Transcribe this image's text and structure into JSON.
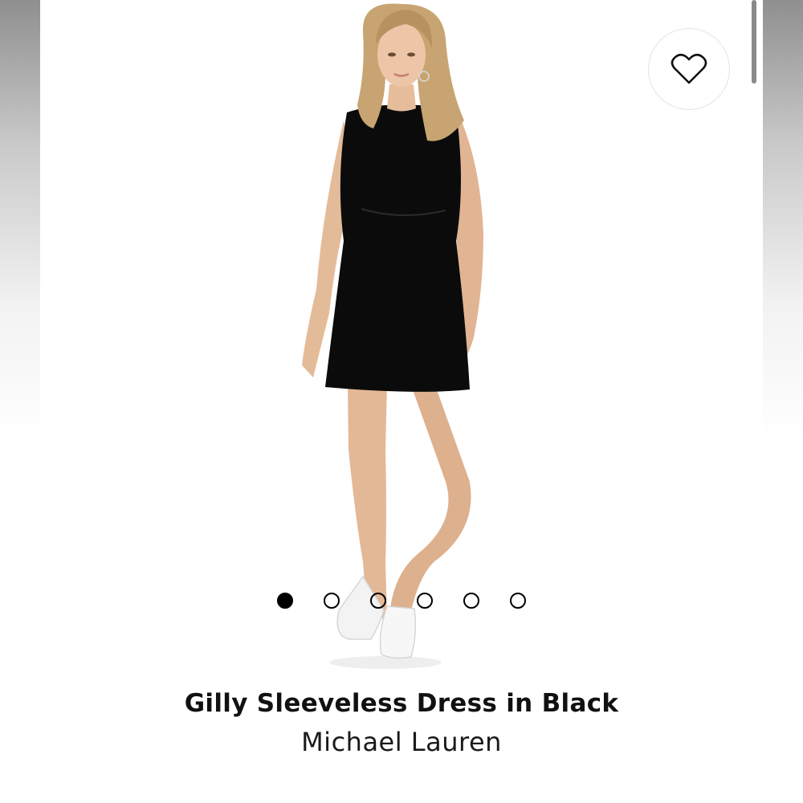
{
  "product": {
    "title": "Gilly Sleeveless Dress in Black",
    "brand": "Michael Lauren"
  },
  "gallery": {
    "image_count": 6,
    "active_index": 0
  },
  "favorite": {
    "icon": "heart-icon"
  },
  "colors": {
    "dress": "#0a0a0a",
    "skin": "#e8c0a0",
    "hair": "#c9a878",
    "sneakers": "#f4f4f4"
  }
}
